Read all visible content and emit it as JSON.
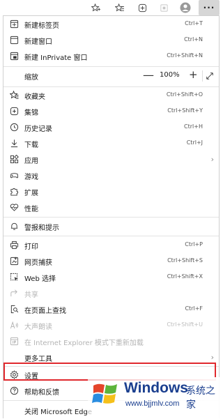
{
  "toolbar": {
    "icons": [
      "tab-star-icon",
      "favorites-icon",
      "collections-icon",
      "extension-icon",
      "profile-icon"
    ],
    "more_label": "···"
  },
  "menu": {
    "new_tab": {
      "label": "新建标签页",
      "shortcut": "Ctrl+T"
    },
    "new_window": {
      "label": "新建窗口",
      "shortcut": "Ctrl+N"
    },
    "new_inprivate": {
      "label": "新建 InPrivate 窗口",
      "shortcut": "Ctrl+Shift+N"
    },
    "zoom": {
      "label": "缩放",
      "minus": "—",
      "value": "100%",
      "plus": "+"
    },
    "favorites": {
      "label": "收藏夹",
      "shortcut": "Ctrl+Shift+O"
    },
    "collections": {
      "label": "集锦",
      "shortcut": "Ctrl+Shift+Y"
    },
    "history": {
      "label": "历史记录",
      "shortcut": "Ctrl+H"
    },
    "downloads": {
      "label": "下载",
      "shortcut": "Ctrl+J"
    },
    "apps": {
      "label": "应用"
    },
    "games": {
      "label": "游戏"
    },
    "extensions": {
      "label": "扩展"
    },
    "performance": {
      "label": "性能"
    },
    "alerts": {
      "label": "警报和提示"
    },
    "print": {
      "label": "打印",
      "shortcut": "Ctrl+P"
    },
    "web_capture": {
      "label": "网页捕获",
      "shortcut": "Ctrl+Shift+S"
    },
    "web_select": {
      "label": "Web 选择",
      "shortcut": "Ctrl+Shift+X"
    },
    "share": {
      "label": "共享"
    },
    "find": {
      "label": "在页面上查找",
      "shortcut": "Ctrl+F"
    },
    "read_aloud": {
      "label": "大声朗读",
      "shortcut": "Ctrl+Shift+U"
    },
    "ie_mode": {
      "label": "在 Internet Explorer 模式下重新加载"
    },
    "more_tools": {
      "label": "更多工具"
    },
    "settings": {
      "label": "设置"
    },
    "help": {
      "label": "帮助和反馈"
    },
    "close": {
      "label": "关闭 Microsoft Edge"
    }
  },
  "watermark": {
    "title": "Windows",
    "subtitle": "系统之家",
    "url": "www.bjjmlv.com"
  },
  "colors": {
    "highlight": "#e0282d",
    "brand": "#1b3f8f"
  }
}
